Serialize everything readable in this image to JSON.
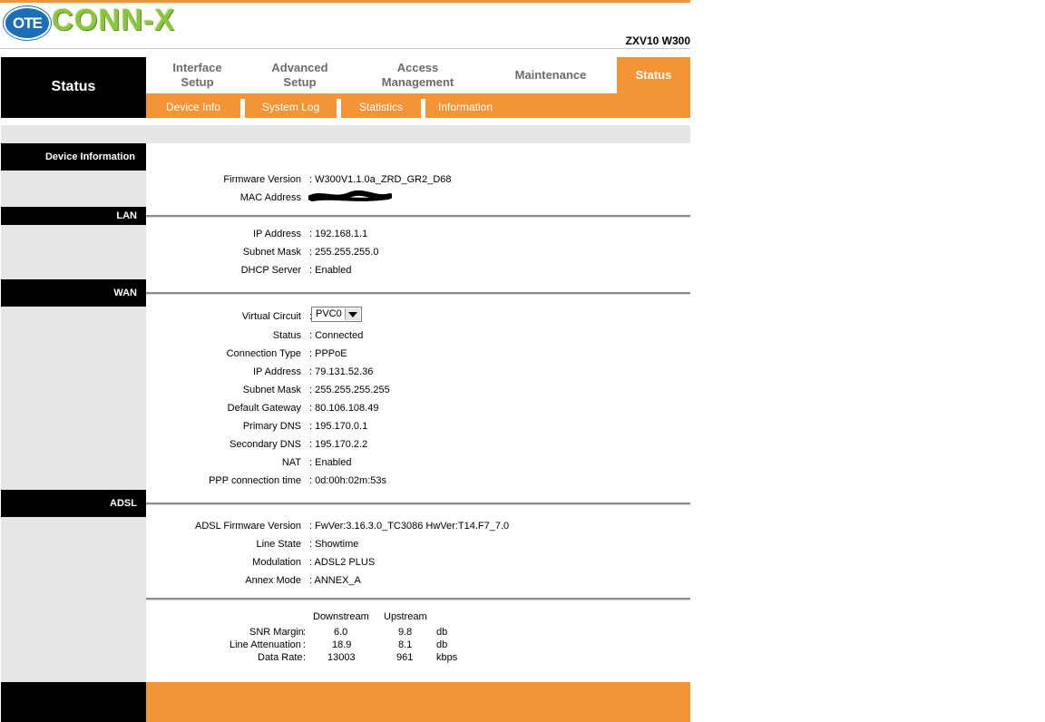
{
  "header": {
    "logo_ote": "OTE",
    "logo_brand": "CONN-X",
    "model": "ZXV10 W300"
  },
  "nav": {
    "section_title": "Status",
    "tabs": [
      {
        "label": "Interface\nSetup"
      },
      {
        "label": "Advanced\nSetup"
      },
      {
        "label": "Access\nManagement"
      },
      {
        "label": "Maintenance"
      },
      {
        "label": "Status",
        "active": true
      }
    ],
    "subtabs": [
      "Device Info",
      "System Log",
      "Statistics",
      "Information"
    ]
  },
  "device": {
    "heading": "Device Information",
    "firmware_label": "Firmware Version",
    "firmware_value": ": W300V1.1.0a_ZRD_GR2_D68",
    "mac_label": "MAC Address",
    "mac_value": ":"
  },
  "lan": {
    "heading": "LAN",
    "ip_label": "IP Address",
    "ip_value": ": 192.168.1.1",
    "mask_label": "Subnet Mask",
    "mask_value": ": 255.255.255.0",
    "dhcp_label": "DHCP Server",
    "dhcp_value": ": Enabled"
  },
  "wan": {
    "heading": "WAN",
    "vc_label": "Virtual Circuit",
    "vc_colon": ":",
    "vc_selected": "PVC0",
    "status_label": "Status",
    "status_value": ": Connected",
    "conn_type_label": "Connection Type",
    "conn_type_value": ": PPPoE",
    "ip_label": "IP Address",
    "ip_value": ": 79.131.52.36",
    "mask_label": "Subnet Mask",
    "mask_value": ": 255.255.255.255",
    "gateway_label": "Default Gateway",
    "gateway_value": ": 80.106.108.49",
    "pdns_label": "Primary DNS",
    "pdns_value": ": 195.170.0.1",
    "sdns_label": "Secondary DNS",
    "sdns_value": ": 195.170.2.2",
    "nat_label": "NAT",
    "nat_value": ": Enabled",
    "ppp_time_label": "PPP connection time",
    "ppp_time_value": ": 0d:00h:02m:53s"
  },
  "adsl": {
    "heading": "ADSL",
    "fw_label": "ADSL Firmware Version",
    "fw_value": ": FwVer:3.16.3.0_TC3086 HwVer:T14.F7_7.0",
    "line_label": "Line State",
    "line_value": ": Showtime",
    "mod_label": "Modulation",
    "mod_value": ": ADSL2 PLUS",
    "annex_label": "Annex Mode",
    "annex_value": ": ANNEX_A",
    "stats": {
      "col_down": "Downstream",
      "col_up": "Upstream",
      "rows": [
        {
          "label": "SNR Margin",
          "colon": ":",
          "down": "6.0",
          "up": "9.8",
          "unit": "db"
        },
        {
          "label": "Line Attenuation",
          "colon": ":",
          "down": "18.9",
          "up": "8.1",
          "unit": "db"
        },
        {
          "label": "Data Rate",
          "colon": ":",
          "down": "13003",
          "up": "961",
          "unit": "kbps"
        }
      ]
    }
  },
  "colors": {
    "accent": "#f39437",
    "sidebar": "#e6e6e6",
    "section_header": "#000000",
    "logo_green": "#8cc63f",
    "logo_blue": "#1a6fb6"
  }
}
